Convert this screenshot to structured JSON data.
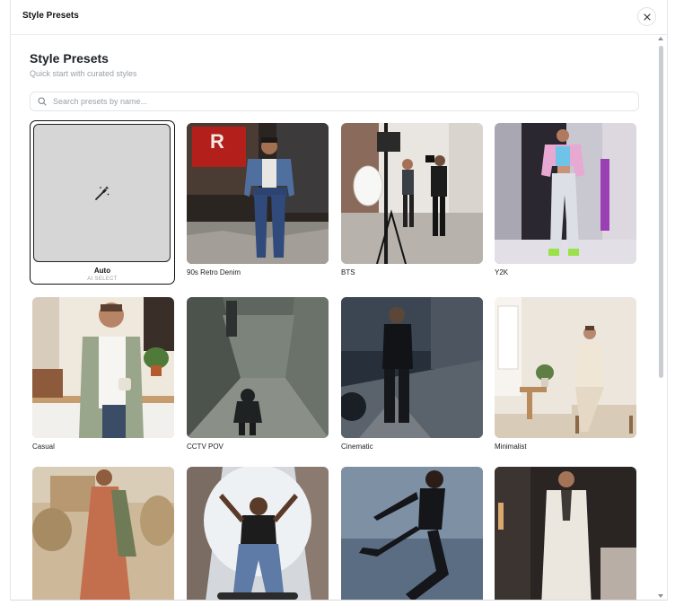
{
  "dialog": {
    "title": "Style Presets"
  },
  "header": {
    "title": "Style Presets",
    "subtitle": "Quick start with curated styles"
  },
  "search": {
    "placeholder": "Search presets by name..."
  },
  "auto_preset": {
    "label": "Auto",
    "sublabel": "AI SELECT"
  },
  "presets": [
    {
      "label": "90s Retro Denim"
    },
    {
      "label": "BTS"
    },
    {
      "label": "Y2K"
    },
    {
      "label": "Casual"
    },
    {
      "label": "CCTV POV"
    },
    {
      "label": "Cinematic"
    },
    {
      "label": "Minimalist"
    }
  ],
  "icons": {
    "close": "close-icon",
    "search": "search-icon",
    "auto": "magic-wand-icon"
  }
}
